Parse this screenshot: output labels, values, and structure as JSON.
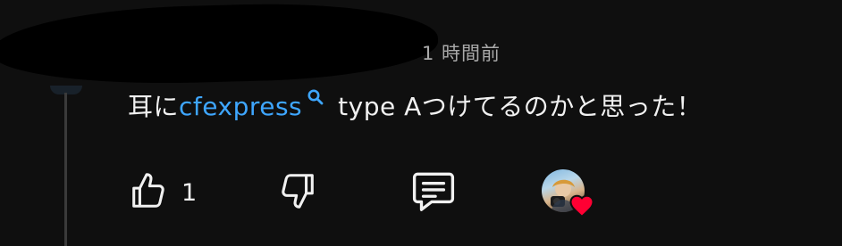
{
  "comment": {
    "timestamp": "1 時間前",
    "text_prefix": "耳に",
    "link_text": "cfexpress",
    "text_suffix": "type Aつけてるのかと思った！"
  },
  "actions": {
    "like_count": "1"
  },
  "icons": {
    "search_mini": "search-icon",
    "like": "thumbs-up-icon",
    "dislike": "thumbs-down-icon",
    "reply": "comment-icon",
    "heart": "heart-icon"
  },
  "colors": {
    "background": "#0f0f0f",
    "text": "#f1f1f1",
    "secondary_text": "#aaaaaa",
    "link": "#3ea6ff",
    "heart": "#ff0033"
  }
}
